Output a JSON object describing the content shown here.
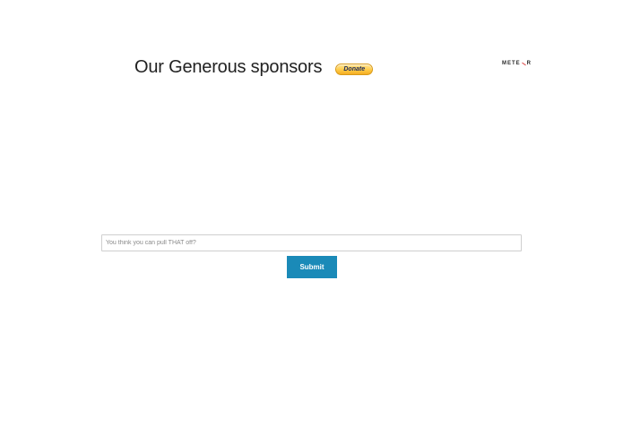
{
  "header": {
    "title": "Our Generous sponsors",
    "donate_label": "Donate"
  },
  "logo": {
    "left_text": "METE",
    "right_text": "R"
  },
  "form": {
    "input_value": "",
    "input_placeholder": "You think you can pull THAT off?",
    "submit_label": "Submit"
  },
  "colors": {
    "submit_bg": "#1a8ab8",
    "donate_gold": "#ffcb47",
    "logo_accent": "#de4f4f"
  }
}
